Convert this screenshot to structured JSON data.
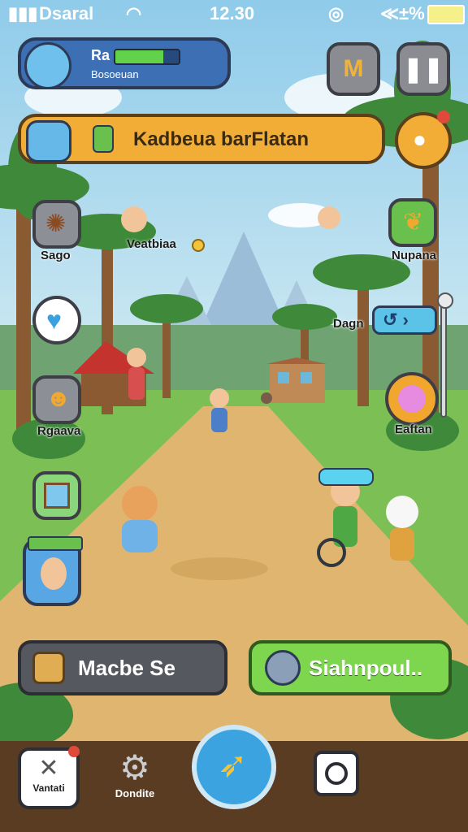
{
  "status_bar": {
    "carrier": "Dsaral",
    "time": "12.30",
    "battery_label": "≪±%"
  },
  "player": {
    "name": "Ra",
    "subtitle": "Bosoeuan",
    "health_fraction": 0.75
  },
  "top_right": {
    "map_button_icon": "map-icon",
    "pause_button_icon": "pause-icon"
  },
  "quest_banner": {
    "text": "Kadbeua barFlatan"
  },
  "left_menu": [
    {
      "label": "Sago",
      "icon": "spider-icon"
    },
    {
      "label": "",
      "icon": "heart-icon"
    },
    {
      "label": "Rgaava",
      "icon": "smile-icon"
    },
    {
      "label": "",
      "icon": "picture-icon"
    }
  ],
  "npc_label": "Veatbiaa",
  "right_menu": [
    {
      "label": "Nupana",
      "icon": "leaf-icon"
    },
    {
      "label": "Dagn",
      "icon": "toggle-icon"
    },
    {
      "label": "Eaftan",
      "icon": "orb-icon"
    }
  ],
  "actions": {
    "left_button": "Macbe Se",
    "right_button": "Siahnpoul.."
  },
  "bottom_nav": {
    "left_label": "Vantati",
    "gear_label": "Dondite"
  }
}
